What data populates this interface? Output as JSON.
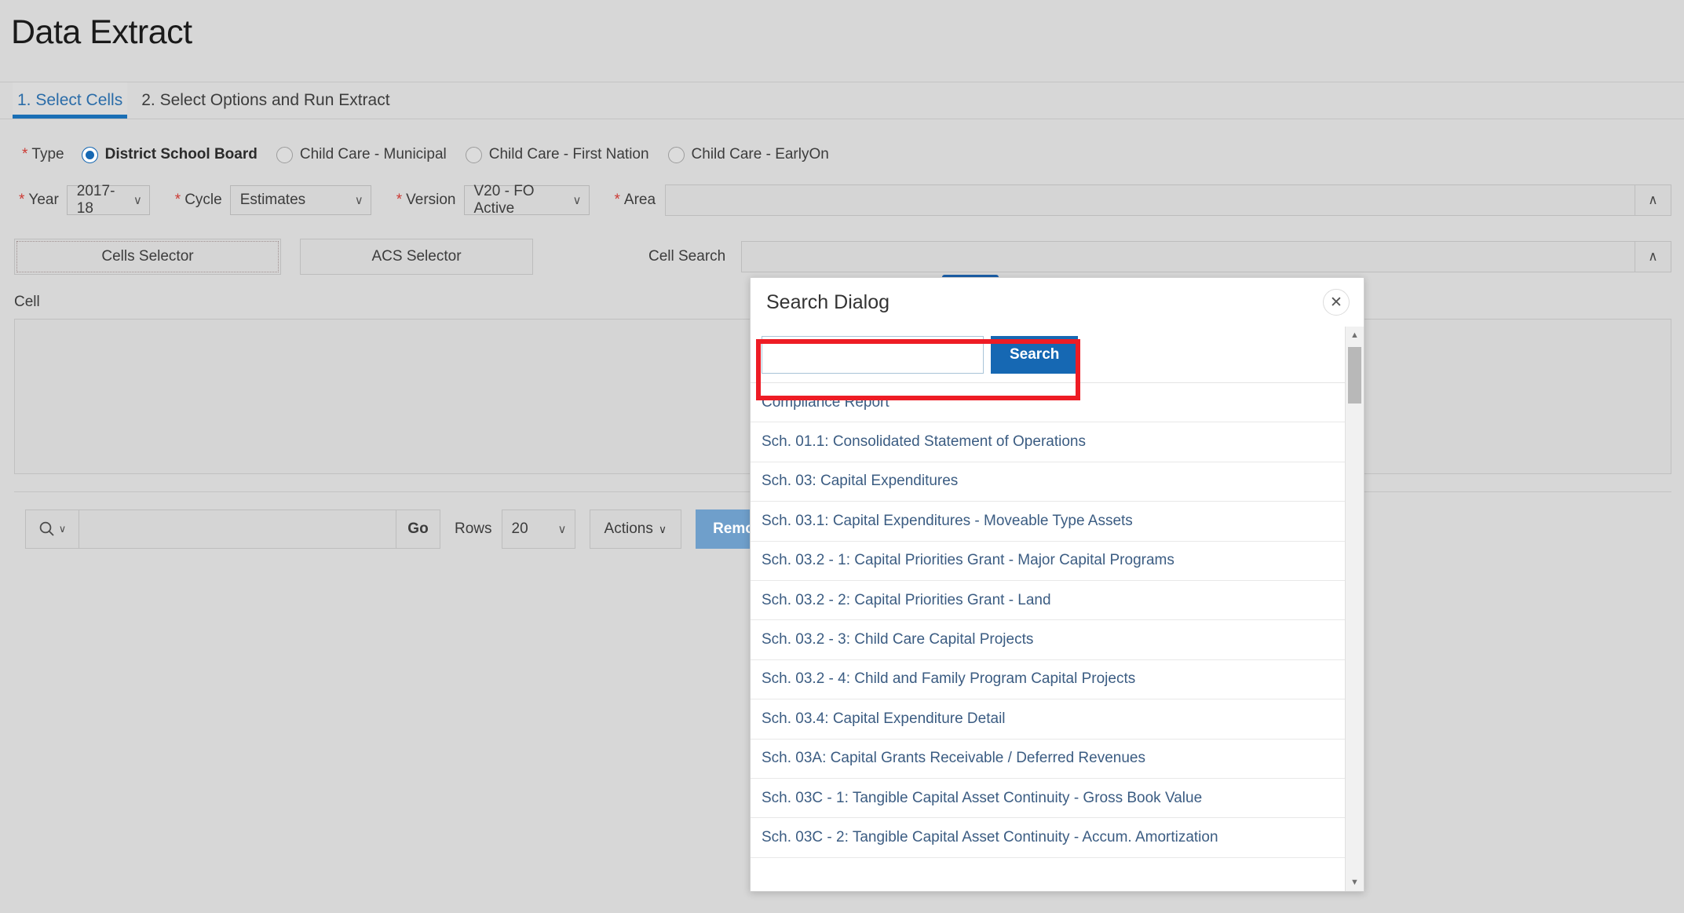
{
  "page": {
    "title": "Data Extract"
  },
  "tabs": [
    {
      "label": "1. Select Cells",
      "active": true
    },
    {
      "label": "2. Select Options and Run Extract",
      "active": false
    }
  ],
  "filters": {
    "type_label": "Type",
    "required_marker": "*",
    "type_options": [
      {
        "label": "District School Board",
        "selected": true
      },
      {
        "label": "Child Care - Municipal",
        "selected": false
      },
      {
        "label": "Child Care - First Nation",
        "selected": false
      },
      {
        "label": "Child Care - EarlyOn",
        "selected": false
      }
    ],
    "year_label": "Year",
    "year_value": "2017-18",
    "cycle_label": "Cycle",
    "cycle_value": "Estimates",
    "version_label": "Version",
    "version_value": "V20 - FO Active",
    "area_label": "Area",
    "area_value": "",
    "chevron_up": "∧",
    "chevron_down": "∨"
  },
  "selectors": {
    "cells_selector": "Cells Selector",
    "acs_selector": "ACS Selector",
    "cell_search_label": "Cell Search"
  },
  "cell_section": {
    "label": "Cell"
  },
  "report_toolbar": {
    "search_icon": "search-icon",
    "search_value": "",
    "go_label": "Go",
    "rows_label": "Rows",
    "rows_value": "20",
    "actions_label": "Actions",
    "remove_label": "Remove",
    "chevron_down": "∨"
  },
  "dialog": {
    "title": "Search Dialog",
    "close_icon": "✕",
    "search_value": "",
    "search_placeholder": "",
    "search_button": "Search",
    "accent_color": "#1668b3",
    "highlight_color": "#ee1c25",
    "link_color": "#3b5c82",
    "scroll_up_icon": "▲",
    "scroll_down_icon": "▼",
    "results": [
      "Compliance Report",
      "Sch. 01.1: Consolidated Statement of Operations",
      "Sch. 03: Capital Expenditures",
      "Sch. 03.1: Capital Expenditures - Moveable Type Assets",
      "Sch. 03.2 - 1: Capital Priorities Grant - Major Capital Programs",
      "Sch. 03.2 - 2: Capital Priorities Grant - Land",
      "Sch. 03.2 - 3: Child Care Capital Projects",
      "Sch. 03.2 - 4: Child and Family Program Capital Projects",
      "Sch. 03.4: Capital Expenditure Detail",
      "Sch. 03A: Capital Grants Receivable / Deferred Revenues",
      "Sch. 03C - 1: Tangible Capital Asset Continuity - Gross Book Value",
      "Sch. 03C - 2: Tangible Capital Asset Continuity - Accum. Amortization"
    ]
  }
}
